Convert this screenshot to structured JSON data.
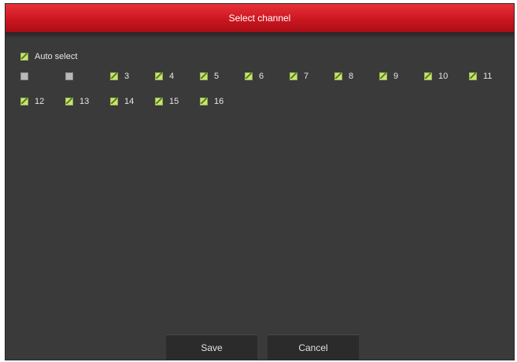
{
  "dialog": {
    "title": "Select channel",
    "auto_select": {
      "label": "Auto select",
      "checked": true
    },
    "channels": [
      {
        "label": "",
        "checked": false
      },
      {
        "label": "",
        "checked": false
      },
      {
        "label": "3",
        "checked": true
      },
      {
        "label": "4",
        "checked": true
      },
      {
        "label": "5",
        "checked": true
      },
      {
        "label": "6",
        "checked": true
      },
      {
        "label": "7",
        "checked": true
      },
      {
        "label": "8",
        "checked": true
      },
      {
        "label": "9",
        "checked": true
      },
      {
        "label": "10",
        "checked": true
      },
      {
        "label": "11",
        "checked": true
      },
      {
        "label": "12",
        "checked": true
      },
      {
        "label": "13",
        "checked": true
      },
      {
        "label": "14",
        "checked": true
      },
      {
        "label": "15",
        "checked": true
      },
      {
        "label": "16",
        "checked": true
      }
    ],
    "buttons": {
      "save": "Save",
      "cancel": "Cancel"
    }
  },
  "colors": {
    "title_bar": "#cc1620",
    "background": "#3a3a3a",
    "checkbox_checked": "#cde07a",
    "checkbox_unchecked": "#b8b8b8"
  }
}
